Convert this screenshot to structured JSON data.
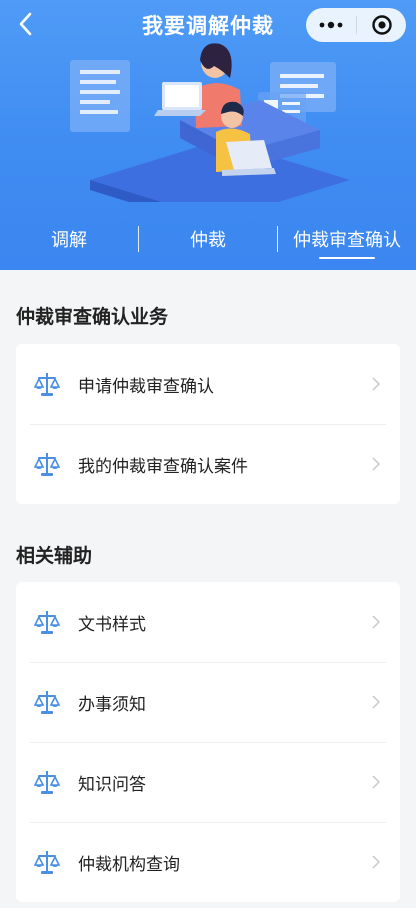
{
  "header": {
    "title": "我要调解仲裁",
    "icons": {
      "back": "chevron-left-icon",
      "more": "more-dots-icon",
      "close": "target-close-icon"
    }
  },
  "tabs": [
    {
      "label": "调解",
      "active": false
    },
    {
      "label": "仲裁",
      "active": false
    },
    {
      "label": "仲裁审查确认",
      "active": true
    }
  ],
  "sections": [
    {
      "title": "仲裁审查确认业务",
      "items": [
        {
          "label": "申请仲裁审查确认",
          "icon": "scales-icon"
        },
        {
          "label": "我的仲裁审查确认案件",
          "icon": "scales-icon"
        }
      ]
    },
    {
      "title": "相关辅助",
      "items": [
        {
          "label": "文书样式",
          "icon": "scales-icon"
        },
        {
          "label": "办事须知",
          "icon": "scales-icon"
        },
        {
          "label": "知识问答",
          "icon": "scales-icon"
        },
        {
          "label": "仲裁机构查询",
          "icon": "scales-icon"
        }
      ]
    }
  ],
  "colors": {
    "brand_blue": "#3f8cf2",
    "icon_blue": "#4a8fe2",
    "background": "#f4f5f7",
    "text": "#222222"
  }
}
